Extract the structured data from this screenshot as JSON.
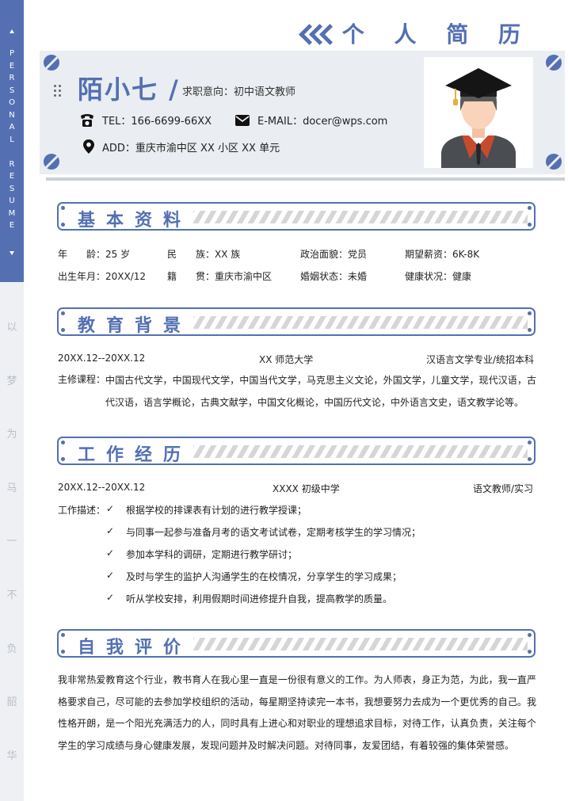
{
  "header": {
    "title": "个 人 简 历",
    "name": "陌小七 /",
    "intention": "求职意向：初中语文教师",
    "tel": "TEL：166-6699-66XX",
    "email": "E-MAIL：docer@wps.com",
    "address": "ADD：重庆市渝中区 XX 小区 XX 单元"
  },
  "sidebar": {
    "vertical_en": [
      "P",
      "E",
      "R",
      "S",
      "O",
      "N",
      "A",
      "L",
      "",
      "R",
      "E",
      "S",
      "U",
      "M",
      "E"
    ],
    "vertical_cn": [
      "以",
      "梦",
      "为",
      "马",
      "一",
      "不",
      "负",
      "韶",
      "华"
    ]
  },
  "sections": {
    "basic": {
      "title": "基本资料",
      "rows": [
        [
          "年　　龄：25 岁",
          "民　　族：XX 族",
          "政治面貌：党员",
          "期望薪资：6K-8K"
        ],
        [
          "出生年月：20XX/12",
          "籍　　贯：重庆市渝中区",
          "婚姻状态：未婚",
          "健康状况：健康"
        ]
      ]
    },
    "education": {
      "title": "教育背景",
      "period": "20XX.12--20XX.12",
      "school": "XX 师范大学",
      "major": "汉语言文学专业/统招本科",
      "course_label": "主修课程：",
      "courses": "中国古代文学，中国现代文学，中国当代文学，马克思主义文论，外国文学，儿童文学，现代汉语，古代汉语，语言学概论，古典文献学，中国文化概论，中国历代文论，中外语言文史，语文教学论等。"
    },
    "work": {
      "title": "工作经历",
      "period": "20XX.12--20XX.12",
      "company": "XXXX 初级中学",
      "position": "语文教师/实习",
      "desc_label": "工作描述：",
      "check": "✓",
      "items": [
        "根据学校的排课表有计划的进行教学授课；",
        "与同事一起参与准备月考的语文考试试卷，定期考核学生的学习情况；",
        "参加本学科的调研，定期进行教学研讨；",
        "及时与学生的监护人沟通学生的在校情况，分享学生的学习成果；",
        "听从学校安排，利用假期时间进修提升自我，提高教学的质量。"
      ]
    },
    "self": {
      "title": "自我评价",
      "text": "我非常热爱教育这个行业，教书育人在我心里一直是一份很有意义的工作。为人师表，身正为范，为此，我一直严格要求自己，尽可能的去参加学校组织的活动，每星期坚持读完一本书，我想要努力去成为一个更优秀的自己。我性格开朗，是一个阳光充满活力的人，同时具有上进心和对职业的理想追求目标，对待工作，认真负责，关注每个学生的学习成绩与身心健康发展，发现问题并及时解决问题。对待同事，友爱团结，有着较强的集体荣誉感。"
    }
  },
  "icons": {
    "phone": "phone-icon",
    "email": "mail-icon",
    "address": "location-pin-icon",
    "avatar": "graduate-avatar-icon"
  },
  "colors": {
    "accent": "#5470b3",
    "card": "#eaedf1",
    "hatch": "#d6d6d6"
  }
}
